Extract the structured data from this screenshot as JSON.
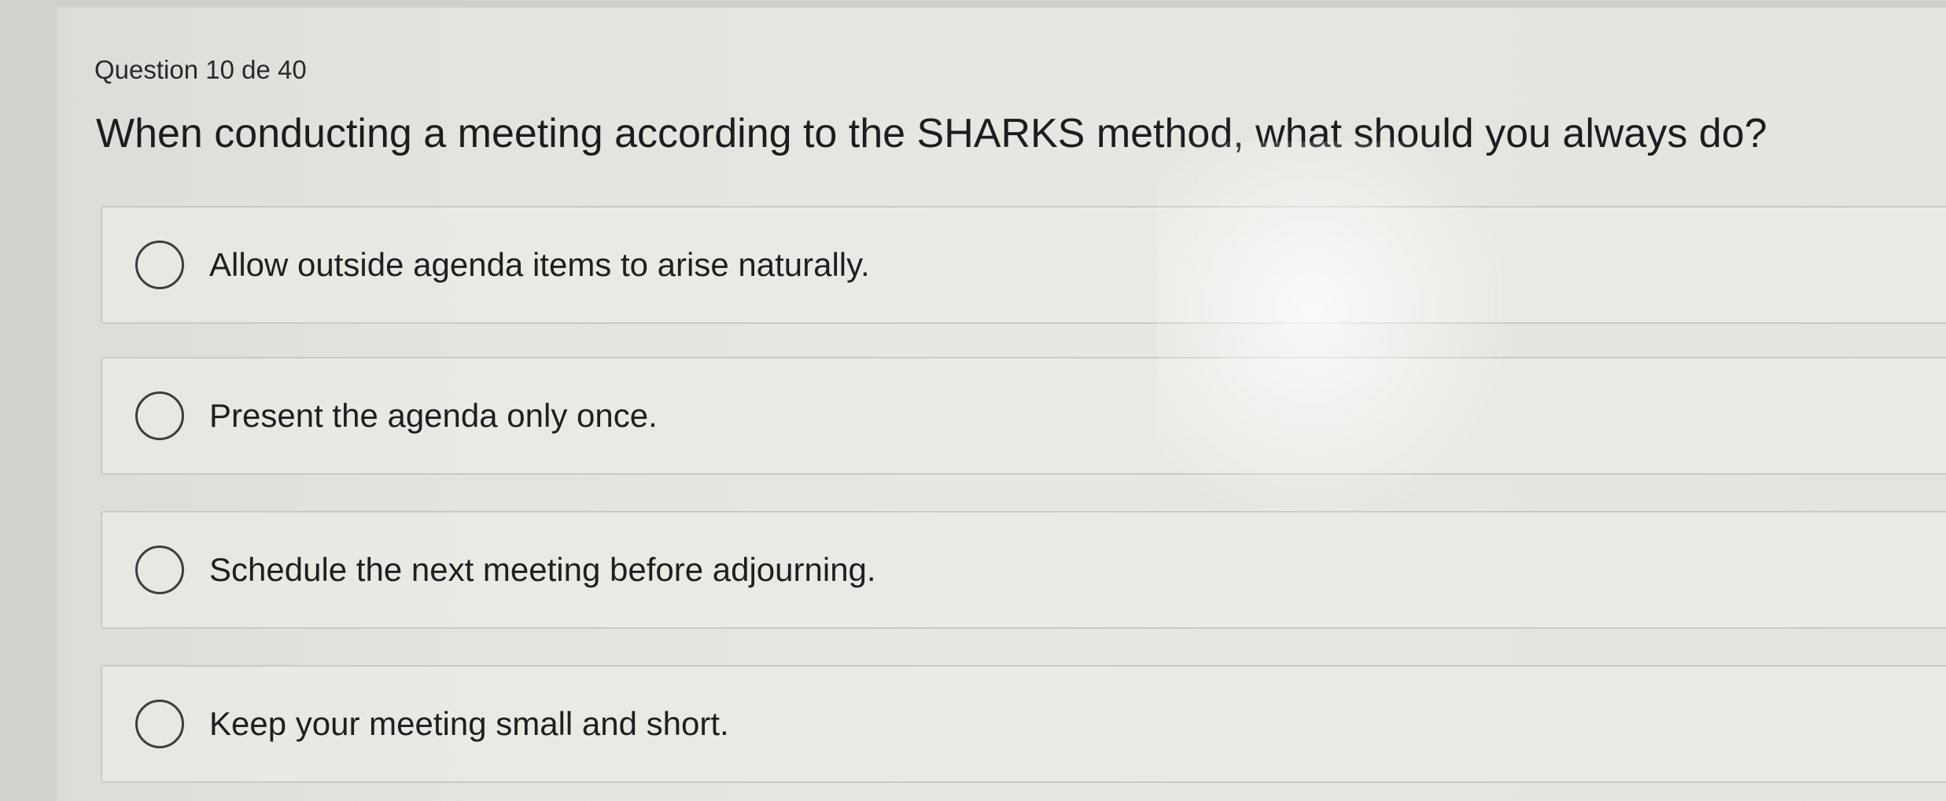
{
  "quiz": {
    "counter": "Question 10 de 40",
    "question": "When conducting a meeting according to the SHARKS method, what should you always do?",
    "options": [
      {
        "label": "Allow outside agenda items to arise naturally.",
        "selected": false
      },
      {
        "label": "Present the agenda only once.",
        "selected": false
      },
      {
        "label": "Schedule the next meeting before adjourning.",
        "selected": false
      },
      {
        "label": "Keep your meeting small and short.",
        "selected": false
      }
    ]
  },
  "colors": {
    "background": "#e4e5e0",
    "text": "#1d1d1d",
    "radio_border": "#3d3d3d",
    "option_border": "#c9cac5"
  }
}
